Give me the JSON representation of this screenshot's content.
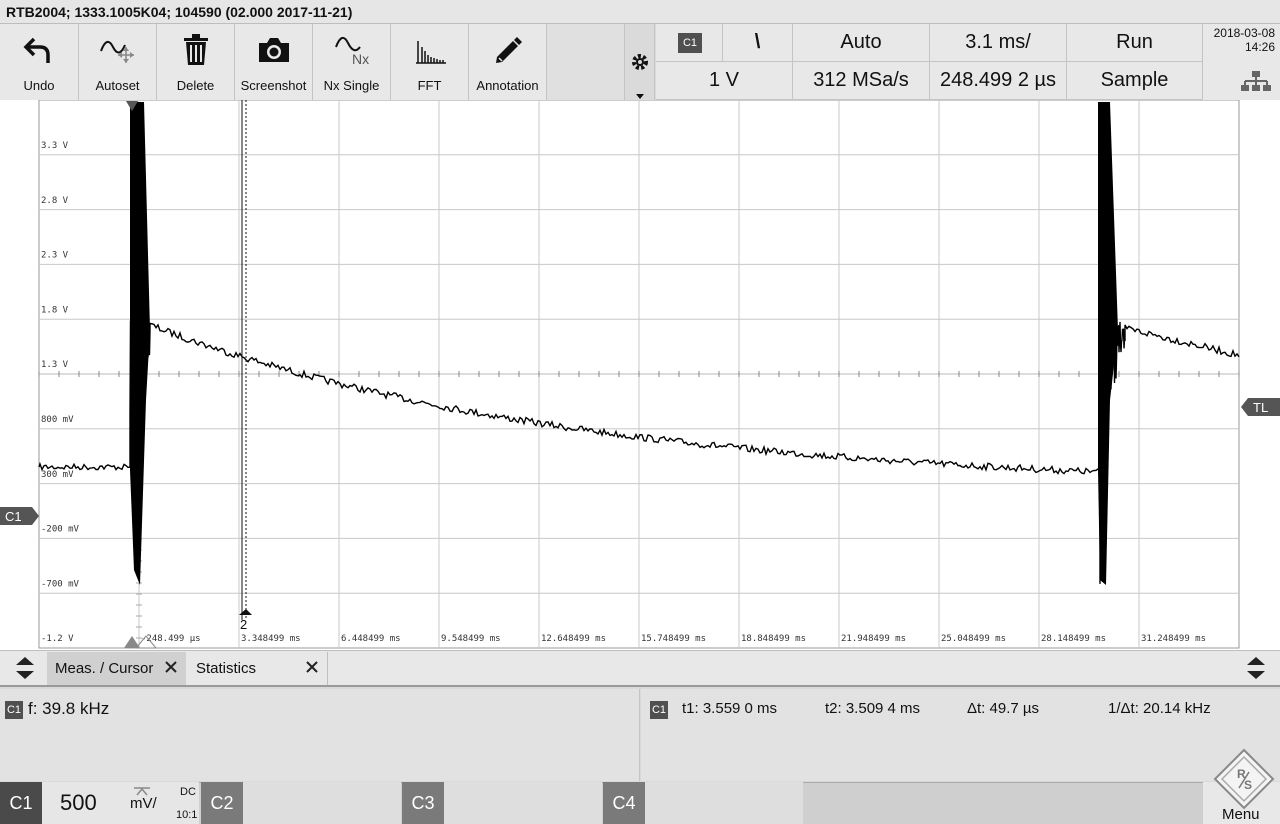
{
  "title": "RTB2004; 1333.1005K04; 104590 (02.000 2017-11-21)",
  "toolbar": {
    "buttons": [
      {
        "label": "Undo",
        "icon": "undo-icon"
      },
      {
        "label": "Autoset",
        "icon": "autoset-icon"
      },
      {
        "label": "Delete",
        "icon": "trash-icon"
      },
      {
        "label": "Screenshot",
        "icon": "camera-icon"
      },
      {
        "label": "Nx Single",
        "icon": "nx-single-icon",
        "icon_text": "Nx"
      },
      {
        "label": "FFT",
        "icon": "fft-icon"
      },
      {
        "label": "Annotation",
        "icon": "pencil-icon"
      }
    ]
  },
  "trigger": {
    "source": "C1",
    "slope_symbol": "\\",
    "mode": "Auto",
    "level": "1 V",
    "time_scale": "3.1 ms/",
    "sample_rate": "312 MSa/s",
    "position": "248.499 2 µs",
    "run_state": "Run",
    "acq_mode": "Sample"
  },
  "datetime": {
    "date": "2018-03-08",
    "time": "14:26"
  },
  "plot": {
    "y_labels": [
      "3.3 V",
      "2.8 V",
      "2.3 V",
      "1.8 V",
      "1.3 V",
      "800 mV",
      "300 mV",
      "-200 mV",
      "-700 mV",
      "-1.2 V"
    ],
    "x_labels": [
      "-248.499 µs",
      "3.348499 ms",
      "6.448499 ms",
      "9.548499 ms",
      "12.648499 ms",
      "15.748499 ms",
      "18.848499 ms",
      "21.948499 ms",
      "25.048499 ms",
      "28.148499 ms",
      "31.248499 ms"
    ],
    "channel_marker": "C1",
    "trigger_level_marker": "TL",
    "cursor_marker": "2",
    "trace_color": "#000000",
    "grid_color": "#c8c8c8"
  },
  "tabs": {
    "active": "Meas. / Cursor",
    "second": "Statistics"
  },
  "measurement": {
    "channel": "C1",
    "text": "f: 39.8 kHz"
  },
  "cursor": {
    "channel": "C1",
    "t1": "t1: 3.559 0 ms",
    "t2": "t2: 3.509 4 ms",
    "dt": "Δt: 49.7 µs",
    "inv_dt": "1/Δt: 20.14 kHz"
  },
  "channels": {
    "c1": {
      "label": "C1",
      "scale": "500",
      "unit": "mV/",
      "coupling": "DC",
      "probe": "10:1"
    },
    "c2": {
      "label": "C2"
    },
    "c3": {
      "label": "C3"
    },
    "c4": {
      "label": "C4"
    }
  },
  "menu_label": "Menu"
}
